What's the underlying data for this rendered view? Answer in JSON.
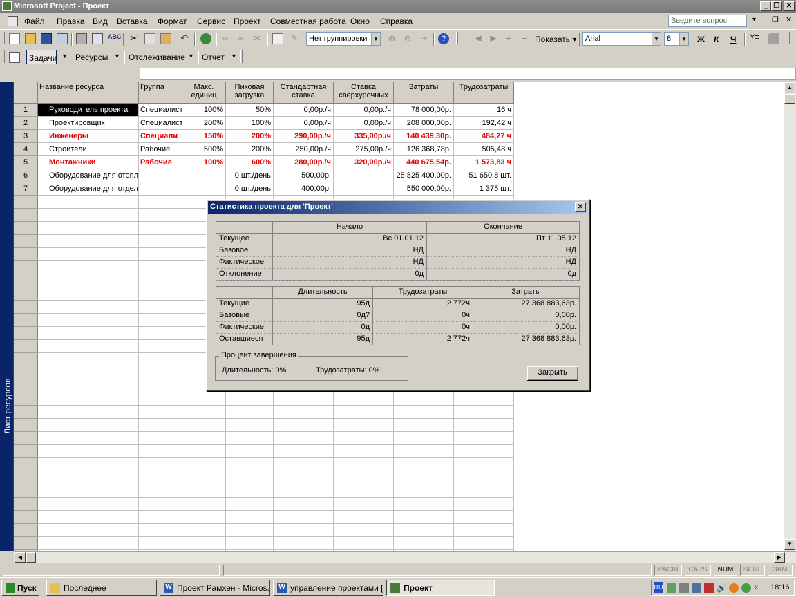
{
  "window": {
    "title": "Microsoft Project - Проект"
  },
  "menu": {
    "items": [
      "Файл",
      "Правка",
      "Вид",
      "Вставка",
      "Формат",
      "Сервис",
      "Проект",
      "Совместная работа",
      "Окно",
      "Справка"
    ],
    "help_placeholder": "Введите вопрос"
  },
  "toolbar": {
    "grouping": "Нет группировки",
    "show_label": "Показать",
    "font": "Arial",
    "font_size": "8",
    "bold": "Ж",
    "italic": "К",
    "underline": "Ч"
  },
  "guide_bar": {
    "tasks": "Задачи",
    "resources": "Ресурсы",
    "tracking": "Отслеживание",
    "report": "Отчет"
  },
  "view_bar": {
    "label": "Лист ресурсов"
  },
  "sheet": {
    "columns": [
      [
        "Название ресурса",
        ""
      ],
      [
        "Группа",
        ""
      ],
      [
        "Макс.",
        "единиц"
      ],
      [
        "Пиковая",
        "загрузка"
      ],
      [
        "Стандартная",
        "ставка"
      ],
      [
        "Ставка",
        "сверхурочных"
      ],
      [
        "Затраты",
        ""
      ],
      [
        "Трудозатраты",
        ""
      ]
    ],
    "rows": [
      {
        "id": "1",
        "name": "Руководитель проекта",
        "group": "Специалист",
        "max": "100%",
        "peak": "50%",
        "std": "0,00р./ч",
        "ovt": "0,00р./ч",
        "cost": "78 000,00р.",
        "work": "16 ч",
        "style": "selected"
      },
      {
        "id": "2",
        "name": "Проектировщик",
        "group": "Специалист",
        "max": "200%",
        "peak": "100%",
        "std": "0,00р./ч",
        "ovt": "0,00р./ч",
        "cost": "208 000,00р.",
        "work": "192,42 ч",
        "style": ""
      },
      {
        "id": "3",
        "name": "Инженеры",
        "group": "Специали",
        "max": "150%",
        "peak": "200%",
        "std": "290,00р./ч",
        "ovt": "335,00р./ч",
        "cost": "140 439,30р.",
        "work": "484,27 ч",
        "style": "over"
      },
      {
        "id": "4",
        "name": "Строители",
        "group": "Рабочие",
        "max": "500%",
        "peak": "200%",
        "std": "250,00р./ч",
        "ovt": "275,00р./ч",
        "cost": "126 368,78р.",
        "work": "505,48 ч",
        "style": ""
      },
      {
        "id": "5",
        "name": "Монтажники",
        "group": "Рабочие",
        "max": "100%",
        "peak": "600%",
        "std": "280,00р./ч",
        "ovt": "320,00р./ч",
        "cost": "440 675,54р.",
        "work": "1 573,83 ч",
        "style": "over"
      },
      {
        "id": "6",
        "name": "Оборудование для отопл",
        "group": "",
        "max": "",
        "peak": "0 шт./день",
        "std": "500,00р.",
        "ovt": "",
        "cost": "25 825 400,00р.",
        "work": "51 650,8 шт.",
        "style": ""
      },
      {
        "id": "7",
        "name": "Оборудование для отдел",
        "group": "",
        "max": "",
        "peak": "0 шт./день",
        "std": "400,00р.",
        "ovt": "",
        "cost": "550 000,00р.",
        "work": "1 375 шт.",
        "style": ""
      }
    ]
  },
  "dialog": {
    "title": "Статистика проекта для 'Проект'",
    "dates": {
      "headers": [
        "",
        "Начало",
        "Окончание"
      ],
      "rows": [
        [
          "Текущее",
          "Вс 01.01.12",
          "Пт 11.05.12"
        ],
        [
          "Базовое",
          "НД",
          "НД"
        ],
        [
          "Фактическое",
          "НД",
          "НД"
        ],
        [
          "Отклонение",
          "0д",
          "0д"
        ]
      ]
    },
    "totals": {
      "headers": [
        "",
        "Длительность",
        "Трудозатраты",
        "Затраты"
      ],
      "rows": [
        [
          "Текущие",
          "95д",
          "2 772ч",
          "27 368 883,63р."
        ],
        [
          "Базовые",
          "0д?",
          "0ч",
          "0,00р."
        ],
        [
          "Фактические",
          "0д",
          "0ч",
          "0,00р."
        ],
        [
          "Оставшиеся",
          "95д",
          "2 772ч",
          "27 368 883,63р."
        ]
      ]
    },
    "completion": {
      "title": "Процент завершения",
      "duration": "Длительность:  0%",
      "work": "Трудозатраты:  0%"
    },
    "close_label": "Закрыть"
  },
  "status": [
    "РАСШ",
    "CAPS",
    "NUM",
    "SCRL",
    "ЗАМ"
  ],
  "taskbar": {
    "start": "Пуск",
    "tasks": [
      "Последнее",
      "Проект Рамхен - Micros...",
      "управление проектами [...",
      "Проект"
    ],
    "lang": "RU",
    "clock": "18:16"
  }
}
